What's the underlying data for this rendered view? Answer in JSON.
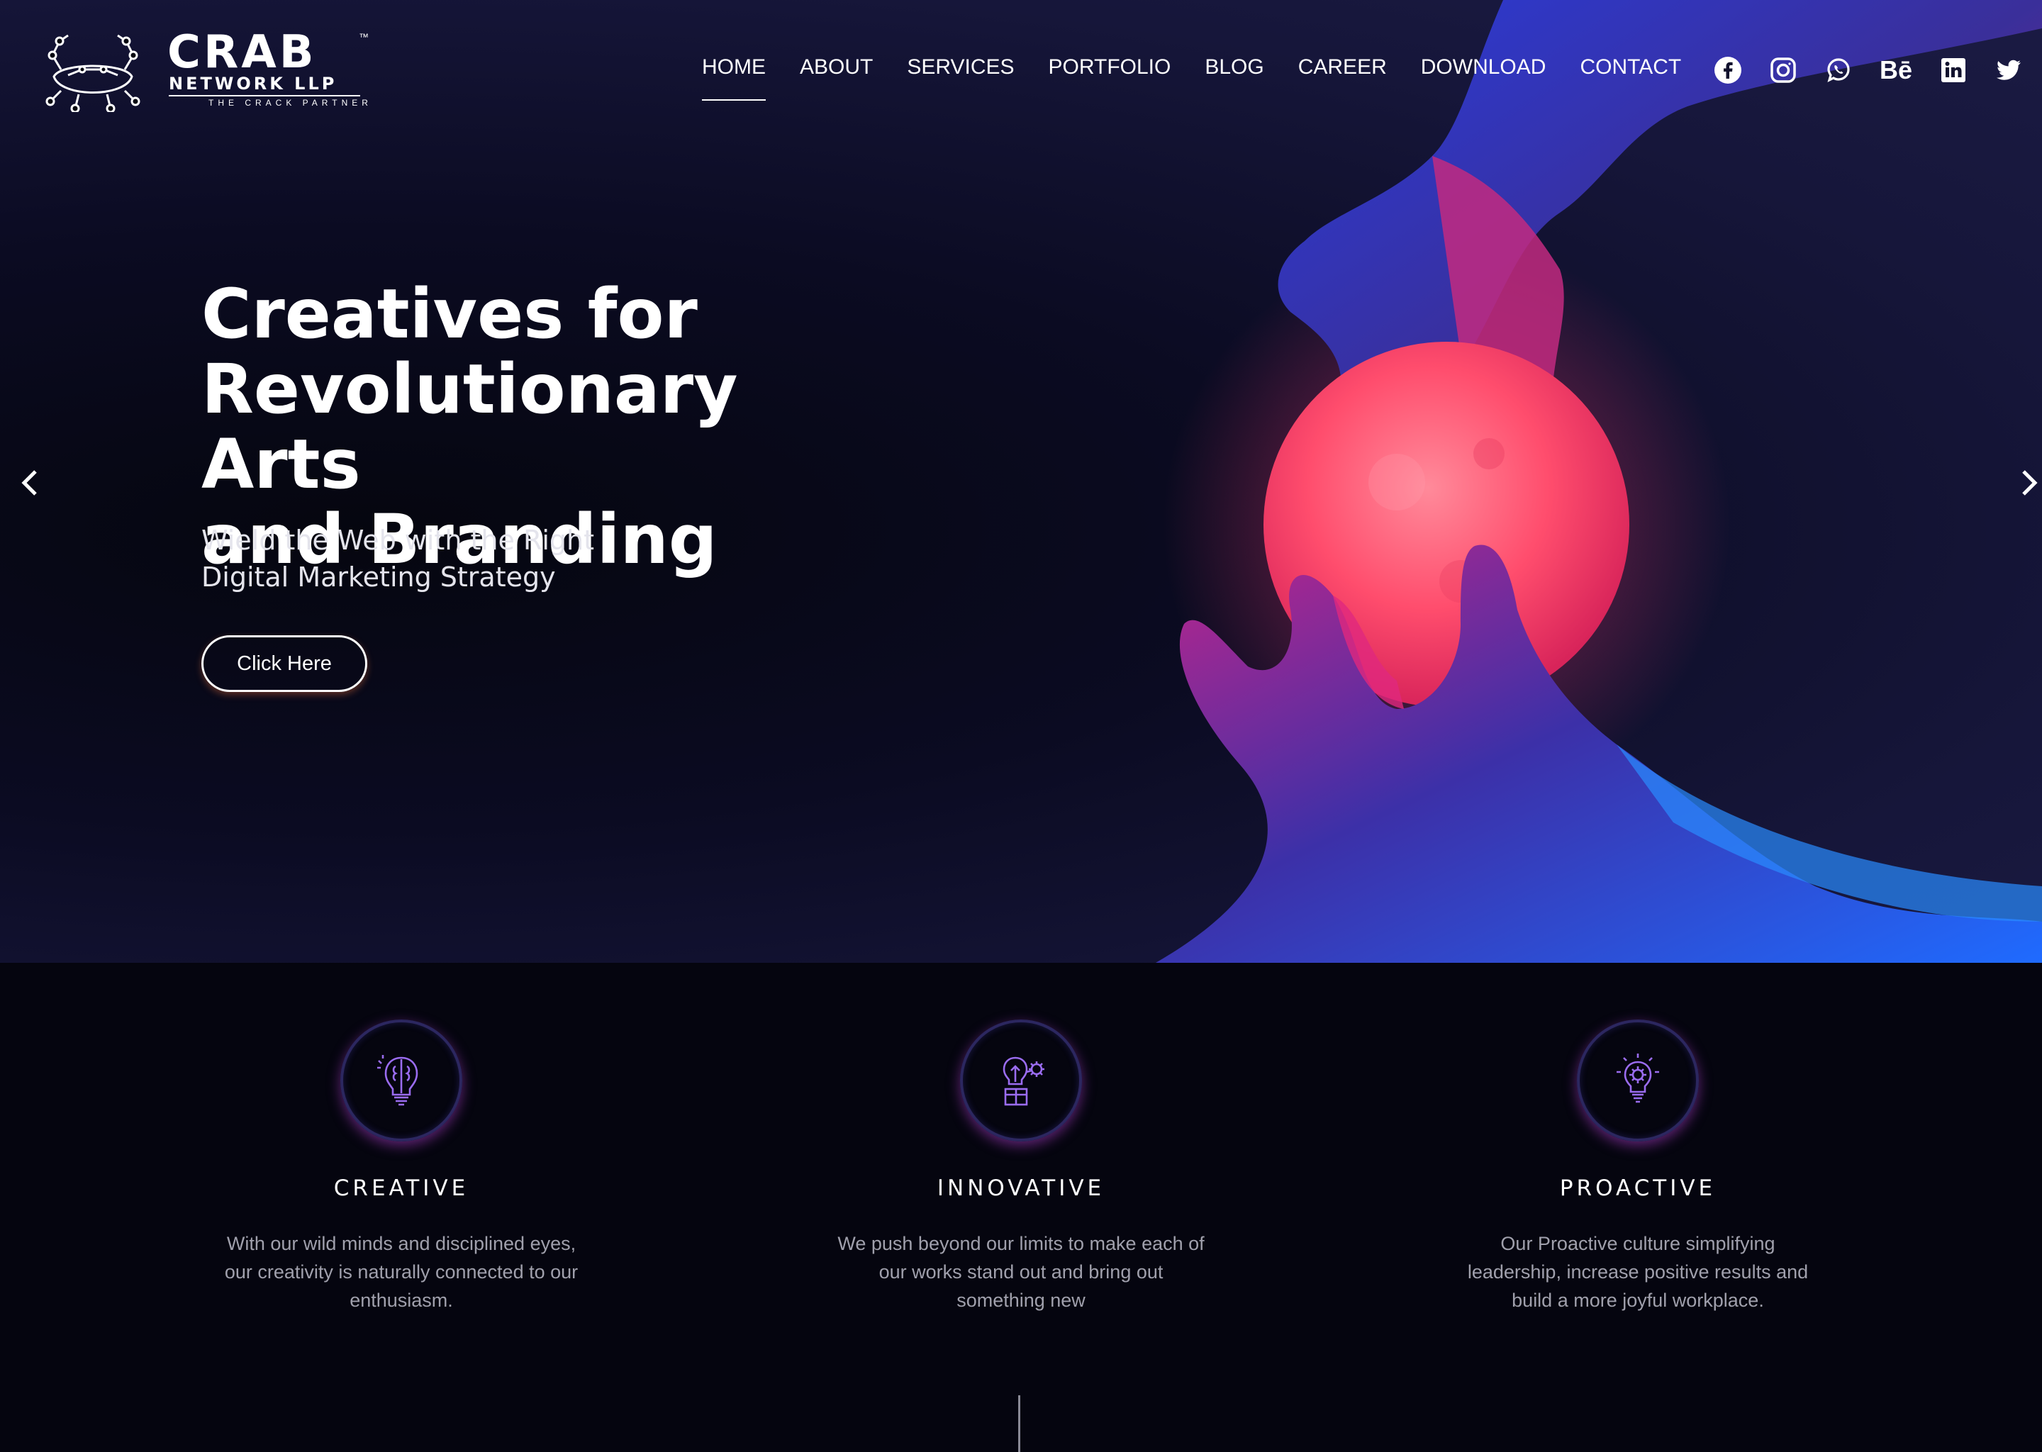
{
  "brand": {
    "name": "CRAB",
    "tm": "™",
    "sub": "NETWORK LLP",
    "tagline": "THE CRACK PARTNER"
  },
  "nav": {
    "items": [
      "HOME",
      "ABOUT",
      "SERVICES",
      "PORTFOLIO",
      "BLOG",
      "CAREER",
      "DOWNLOAD",
      "CONTACT"
    ],
    "active": "HOME"
  },
  "social": [
    "facebook-icon",
    "instagram-icon",
    "whatsapp-icon",
    "behance-icon",
    "linkedin-icon",
    "twitter-icon"
  ],
  "social_behance_text": "Bē",
  "hero": {
    "headline": [
      "Creatives for",
      "Revolutionary Arts",
      "and Branding"
    ],
    "subhead": [
      "Wield the Web with the Right",
      "Digital Marketing Strategy"
    ],
    "cta_label": "Click Here"
  },
  "features": [
    {
      "icon": "brain-bulb-icon",
      "title": "CREATIVE",
      "desc": [
        "With our wild minds and disciplined eyes,",
        "our creativity is naturally connected to our",
        "enthusiasm."
      ]
    },
    {
      "icon": "bulb-gear-icon",
      "title": "INNOVATIVE",
      "desc": [
        "We push beyond our limits to make each of",
        "our works stand out and bring out",
        "something new"
      ]
    },
    {
      "icon": "gear-bulb-icon",
      "title": "PROACTIVE",
      "desc": [
        "Our Proactive culture simplifying",
        "leadership, increase positive results and",
        "build a more joyful workplace."
      ]
    }
  ],
  "colors": {
    "hero_bg": "#16163a",
    "features_bg": "#05050f",
    "icon_purple": "#8b5cf6",
    "sphere": "#ff4d6d"
  }
}
